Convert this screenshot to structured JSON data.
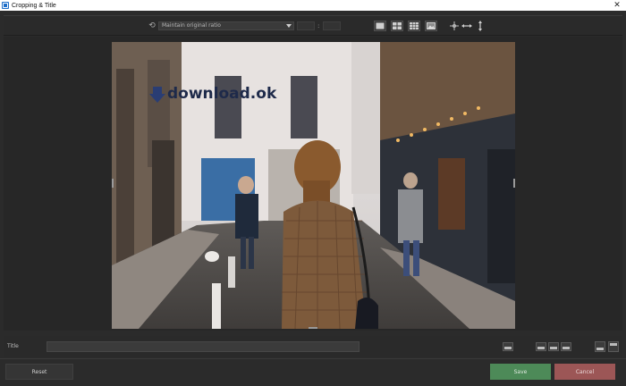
{
  "window": {
    "title": "Cropping & Title",
    "close_glyph": "✕"
  },
  "toolbar": {
    "rotate_icon": "rotate-icon",
    "aspect_select": {
      "value": "Maintain original ratio"
    },
    "width_value": "",
    "separator": ":",
    "height_value": "",
    "grid_icons": [
      "grid-single-icon",
      "grid-2x2-icon",
      "grid-3x3-icon",
      "photo-fit-icon"
    ],
    "align_icons": [
      "crosshair-center-icon",
      "fit-width-icon",
      "fit-height-icon"
    ]
  },
  "preview": {
    "watermark_text": "download.ok"
  },
  "title_bar": {
    "label": "Title",
    "value": "",
    "position_icons": [
      "caption-inside-icon",
      "caption-left-icon",
      "caption-center-icon",
      "caption-right-icon",
      "caption-below-icon",
      "caption-above-icon"
    ]
  },
  "footer": {
    "reset_label": "Reset",
    "save_label": "Save",
    "cancel_label": "Cancel"
  },
  "colors": {
    "save": "#4d8a58",
    "cancel": "#9c5656",
    "app_icon": "#1f6fc9",
    "background": "#2b2b2b"
  }
}
